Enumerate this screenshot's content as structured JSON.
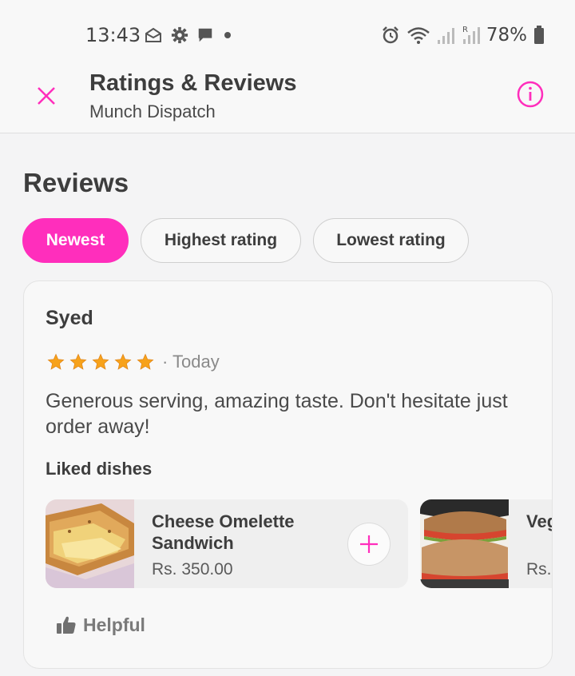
{
  "status_bar": {
    "time": "13:43",
    "battery": "78%",
    "left_icons": [
      "mail-open-icon",
      "gear-icon",
      "chat-icon",
      "dot-icon"
    ],
    "right_icons": [
      "alarm-icon",
      "wifi-icon",
      "signal-icon",
      "signal-roaming-icon",
      "battery-icon"
    ]
  },
  "header": {
    "title": "Ratings & Reviews",
    "subtitle": "Munch Dispatch",
    "close_icon": "close-icon",
    "info_icon": "info-icon"
  },
  "reviews": {
    "section_title": "Reviews",
    "filters": [
      {
        "label": "Newest",
        "active": true
      },
      {
        "label": "Highest rating",
        "active": false
      },
      {
        "label": "Lowest rating",
        "active": false
      }
    ]
  },
  "review": {
    "reviewer": "Syed",
    "rating": 5,
    "date": "· Today",
    "text": "Generous serving, amazing taste. Don't hesitate just order away!",
    "liked_label": "Liked dishes",
    "dishes": [
      {
        "name": "Cheese Omelette Sandwich",
        "price": "Rs. 350.00"
      },
      {
        "name": "Veg Sandwich",
        "price": "Rs."
      }
    ],
    "helpful_label": "Helpful"
  },
  "colors": {
    "accent": "#ff2ebc",
    "star": "#f7a21b"
  }
}
